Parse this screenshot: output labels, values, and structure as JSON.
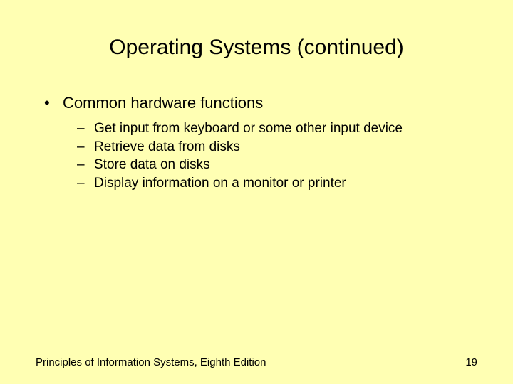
{
  "title": "Operating Systems (continued)",
  "main_bullet": "Common hardware functions",
  "sub_bullets": {
    "item0": "Get input from keyboard or some other input device",
    "item1": "Retrieve data from disks",
    "item2": "Store data on disks",
    "item3": "Display information on a monitor or printer"
  },
  "footer": {
    "text": "Principles of Information Systems, Eighth Edition",
    "page": "19"
  }
}
